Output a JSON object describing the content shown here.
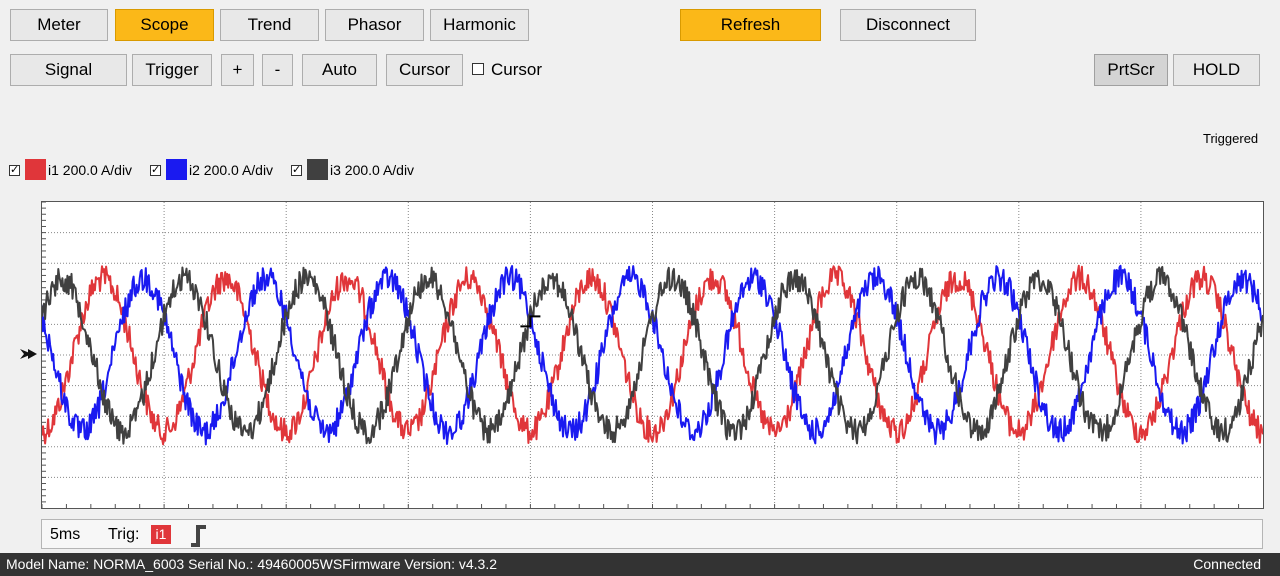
{
  "tabs": [
    {
      "label": "Meter",
      "active": false
    },
    {
      "label": "Scope",
      "active": true
    },
    {
      "label": "Trend",
      "active": false
    },
    {
      "label": "Phasor",
      "active": false
    },
    {
      "label": "Harmonic",
      "active": false
    }
  ],
  "actions": {
    "refresh": "Refresh",
    "disconnect": "Disconnect"
  },
  "toolbar": {
    "signal": "Signal",
    "trigger": "Trigger",
    "plus": "+",
    "minus": "-",
    "auto": "Auto",
    "cursor_button": "Cursor",
    "cursor_check_label": "Cursor",
    "cursor_checked": false,
    "prtscr": "PrtScr",
    "hold": "HOLD"
  },
  "status_trigger": "Triggered",
  "legend": [
    {
      "label": "i1 200.0 A/div",
      "color": "#e0363a",
      "checked": true
    },
    {
      "label": "i2 200.0 A/div",
      "color": "#1a1af0",
      "checked": true
    },
    {
      "label": "i3 200.0 A/div",
      "color": "#404040",
      "checked": true
    }
  ],
  "timebase": "5ms",
  "trig_label": "Trig:",
  "trig_channel": "i1",
  "statusbar": {
    "info": "Model Name:  NORMA_6003 Serial No.:  49460005WSFirmware Version:  v4.3.2",
    "connection": "Connected"
  },
  "chart_data": {
    "type": "line",
    "divisions": {
      "x": 10,
      "y": 10
    },
    "grid": true,
    "series": [
      {
        "name": "i1",
        "color": "#e0363a",
        "amplitude_div": 2.5,
        "cycles": 10,
        "phase_deg": -90,
        "noise": "high"
      },
      {
        "name": "i2",
        "color": "#1a1af0",
        "amplitude_div": 2.5,
        "cycles": 10,
        "phase_deg": 150,
        "noise": "high"
      },
      {
        "name": "i3",
        "color": "#404040",
        "amplitude_div": 2.5,
        "cycles": 10,
        "phase_deg": 30,
        "noise": "high"
      }
    ]
  }
}
